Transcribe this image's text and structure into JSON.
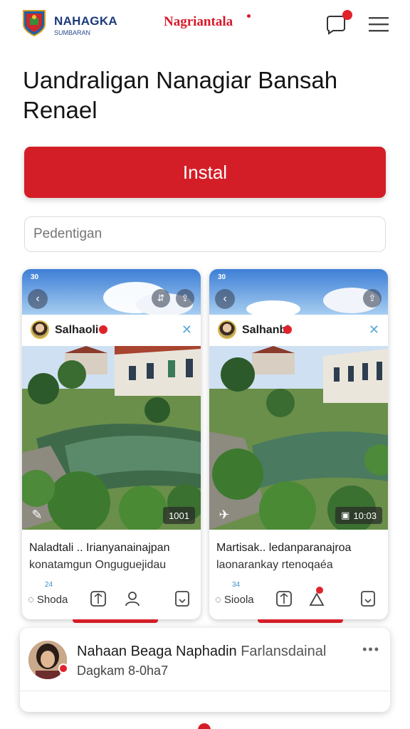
{
  "header": {
    "brand_name": "NAHAGKA",
    "brand_sub": "SUMBARAN",
    "center_title": "Nagriantala",
    "colors": {
      "accent": "#d41e27",
      "brand": "#1b3a7a"
    },
    "icons": [
      "shield-logo-icon",
      "notification-book-icon",
      "hamburger-menu-icon"
    ]
  },
  "headline": "Uandraligan Nanagiar Bansah Renael",
  "install_label": "Instal",
  "search": {
    "placeholder": "Pedentigan"
  },
  "cards": [
    {
      "status_time": "30",
      "user": "Salhaoli",
      "photo_badge": "1001",
      "caption_line1": "Naladtali .. Irianyanainajpan",
      "caption_line2": "konatamgun Onguguejidau",
      "share_label": "Shoda",
      "share_mini": "24"
    },
    {
      "status_time": "30",
      "user": "Salhanbl",
      "photo_badge": "10:03",
      "caption_line1": "Martisak.. ledanparanajroa",
      "caption_line2": "laonarankay rtenoqaéa",
      "share_label": "Sioola",
      "share_mini": "34"
    }
  ],
  "profile": {
    "name": "Nahaan Beaga Naphadin",
    "role": "Farlansdainal",
    "sub": "Dagkam 8-0ha7"
  }
}
